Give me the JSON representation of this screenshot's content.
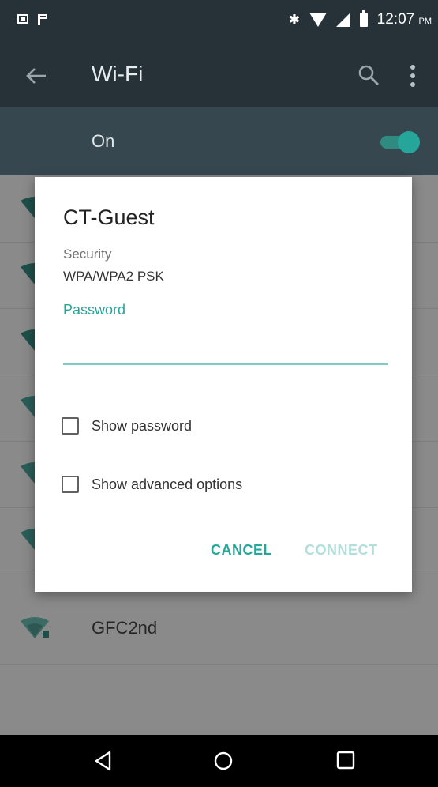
{
  "status_bar": {
    "time": "12:07",
    "ampm": "PM",
    "icons": [
      "notification-box-icon",
      "notification-flag-icon",
      "bluetooth-icon",
      "wifi-icon",
      "cellular-signal-icon",
      "battery-icon"
    ]
  },
  "toolbar": {
    "title": "Wi-Fi",
    "icons": [
      "back-arrow-icon",
      "search-icon",
      "more-vert-icon"
    ]
  },
  "wifi_switch": {
    "label": "On",
    "state": "on"
  },
  "networks": [
    {
      "name": ""
    },
    {
      "name": ""
    },
    {
      "name": ""
    },
    {
      "name": ""
    },
    {
      "name": ""
    },
    {
      "name": ""
    },
    {
      "name": "GFC2nd"
    }
  ],
  "dialog": {
    "title": "CT-Guest",
    "security_label": "Security",
    "security_value": "WPA/WPA2 PSK",
    "password_label": "Password",
    "password_value": "",
    "show_password_label": "Show password",
    "show_advanced_label": "Show advanced options",
    "cancel_label": "CANCEL",
    "connect_label": "CONNECT"
  },
  "nav_bar": {
    "icons": [
      "nav-back-icon",
      "nav-home-icon",
      "nav-recents-icon"
    ]
  },
  "colors": {
    "accent": "#26a69a",
    "toolbar": "#263238",
    "scrim_list": "#8a8a8a"
  }
}
